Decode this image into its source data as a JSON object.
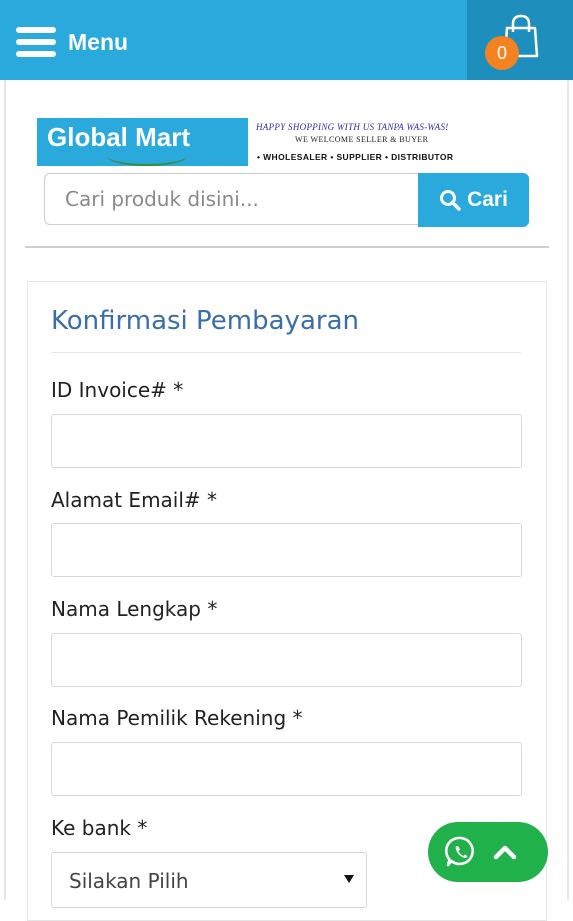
{
  "header": {
    "menu_label": "Menu",
    "cart_count": "0",
    "colors": {
      "bar": "#29a9dc",
      "cart_bg": "#1e8fbd",
      "badge": "#f58220"
    }
  },
  "logo": {
    "brand": "Global Mart",
    "tagline1": "HAPPY SHOPPING WITH US TANPA WAS-WAS!",
    "tagline2": "WE WELCOME SELLER & BUYER",
    "tagline3": "• WHOLESALER  •  SUPPLIER  •  DISTRIBUTOR"
  },
  "search": {
    "placeholder": "Cari produk disini...",
    "value": "",
    "button_label": "Cari",
    "icon": "search-icon"
  },
  "form": {
    "title": "Konfirmasi Pembayaran",
    "fields": [
      {
        "label": "ID Invoice# *",
        "value": ""
      },
      {
        "label": "Alamat Email# *",
        "value": ""
      },
      {
        "label": "Nama Lengkap *",
        "value": ""
      },
      {
        "label": "Nama Pemilik Rekening *",
        "value": ""
      }
    ],
    "bank": {
      "label": "Ke bank *",
      "selected": "Silakan Pilih"
    }
  },
  "floating": {
    "whatsapp_icon": "whatsapp-icon",
    "up_icon": "chevron-up-icon",
    "color": "#21b14a"
  }
}
